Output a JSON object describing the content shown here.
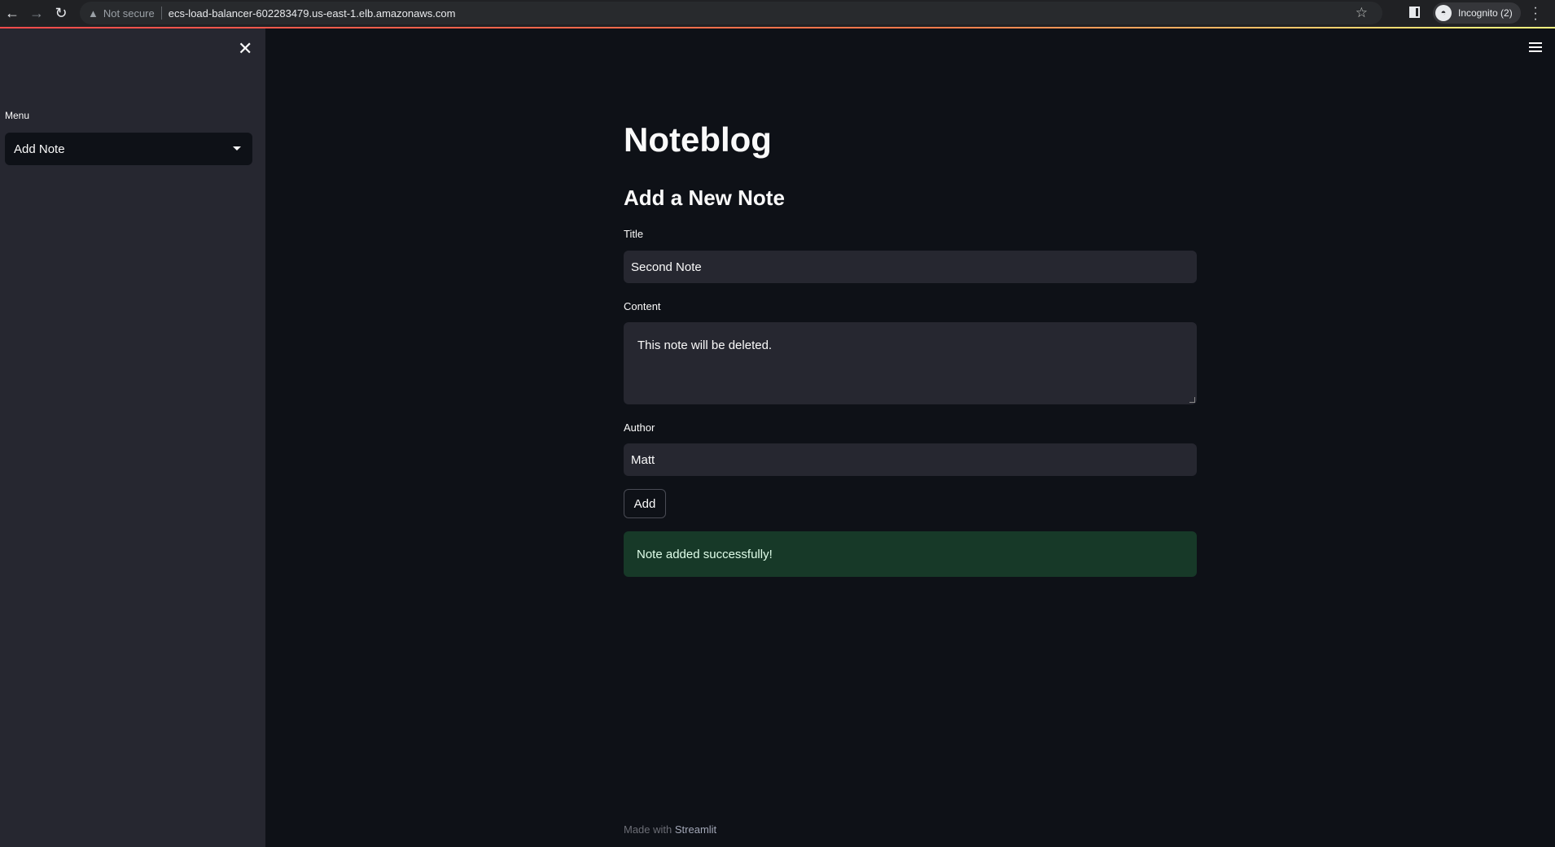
{
  "browser": {
    "security": "Not secure",
    "url": "ecs-load-balancer-602283479.us-east-1.elb.amazonaws.com",
    "profile": "Incognito (2)"
  },
  "sidebar": {
    "menu_label": "Menu",
    "menu_selected": "Add Note"
  },
  "main": {
    "title": "Noteblog",
    "subtitle": "Add a New Note",
    "fields": {
      "title_label": "Title",
      "title_value": "Second Note",
      "content_label": "Content",
      "content_value": "This note will be deleted.",
      "author_label": "Author",
      "author_value": "Matt"
    },
    "add_label": "Add",
    "success": "Note added successfully!"
  },
  "footer": {
    "prefix": "Made with",
    "brand": "Streamlit"
  }
}
